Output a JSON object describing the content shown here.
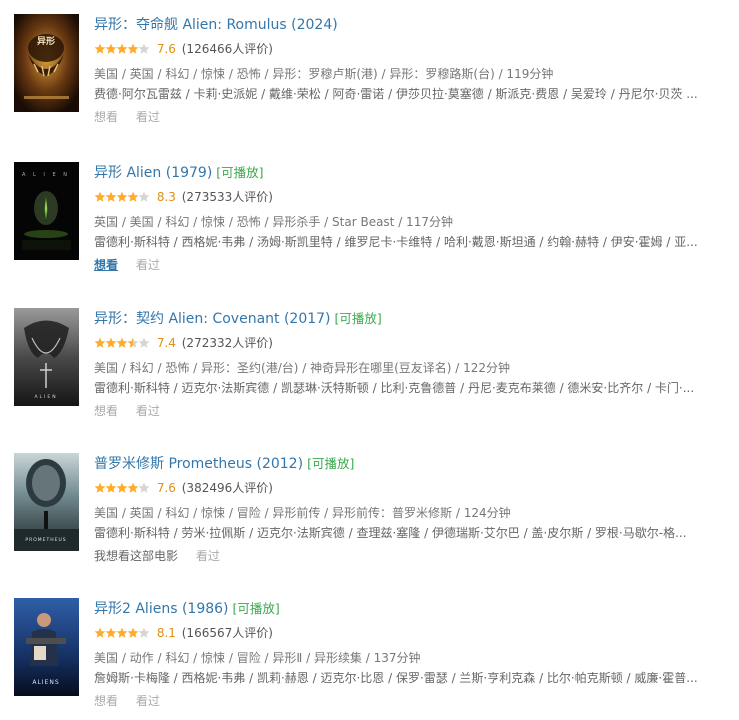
{
  "colors": {
    "title_link": "#3377aa",
    "playable": "#3ba94d",
    "star": "#ffac2d",
    "score": "#e09015"
  },
  "items": [
    {
      "title": "异形：夺命舰 Alien: Romulus (2024)",
      "playable": "",
      "stars": 4,
      "score": "7.6",
      "votes": "(126466人评价)",
      "meta": "美国 / 英国 / 科幻 / 惊悚 / 恐怖 / 异形：罗穆卢斯(港) / 异形：罗穆路斯(台) / 119分钟",
      "cast": "费德·阿尔瓦雷兹 / 卡莉·史派妮 / 戴维·荣松 / 阿奇·雷诺 / 伊莎贝拉·莫塞德 / 斯派克·费恩 / 吴爱玲 / 丹尼尔·贝茨 ...",
      "want": "想看",
      "seen": "看过",
      "poster_icon": "alien-romulus-poster"
    },
    {
      "title": "异形 Alien (1979)",
      "playable": "[可播放]",
      "stars": 4,
      "score": "8.3",
      "votes": "(273533人评价)",
      "meta": "英国 / 美国 / 科幻 / 惊悚 / 恐怖 / 异形杀手 / Star Beast / 117分钟",
      "cast": "雷德利·斯科特 / 西格妮·韦弗 / 汤姆·斯凯里特 / 维罗尼卡·卡维特 / 哈利·戴恩·斯坦通 / 约翰·赫特 / 伊安·霍姆 / 亚...",
      "want": "想看",
      "seen": "看过",
      "poster_icon": "alien-egg-poster"
    },
    {
      "title": "异形：契约 Alien: Covenant (2017)",
      "playable": "[可播放]",
      "stars": 3.5,
      "score": "7.4",
      "votes": "(272332人评价)",
      "meta": "美国 / 科幻 / 恐怖 / 异形：圣约(港/台) / 神奇异形在哪里(豆友译名) / 122分钟",
      "cast": "雷德利·斯科特 / 迈克尔·法斯宾德 / 凯瑟琳·沃特斯顿 / 比利·克鲁德普 / 丹尼·麦克布莱德 / 德米安·比齐尔 / 卡门·...",
      "want": "想看",
      "seen": "看过",
      "poster_icon": "alien-covenant-poster"
    },
    {
      "title": "普罗米修斯 Prometheus (2012)",
      "playable": "[可播放]",
      "stars": 4,
      "score": "7.6",
      "votes": "(382496人评价)",
      "meta": "美国 / 英国 / 科幻 / 惊悚 / 冒险 / 异形前传 / 异形前传：普罗米修斯 / 124分钟",
      "cast": "雷德利·斯科特 / 劳米·拉佩斯 / 迈克尔·法斯宾德 / 查理兹·塞隆 / 伊德瑞斯·艾尔巴 / 盖·皮尔斯 / 罗根·马歇尔-格...",
      "want": "我想看这部电影",
      "seen": "看过",
      "poster_icon": "prometheus-poster"
    },
    {
      "title": "异形2 Aliens (1986)",
      "playable": "[可播放]",
      "stars": 4,
      "score": "8.1",
      "votes": "(166567人评价)",
      "meta": "美国 / 动作 / 科幻 / 惊悚 / 冒险 / 异形Ⅱ / 异形续集 / 137分钟",
      "cast": "詹姆斯·卡梅隆 / 西格妮·韦弗 / 凯莉·赫恩 / 迈克尔·比恩 / 保罗·雷瑟 / 兰斯·亨利克森 / 比尔·帕克斯顿 / 威廉·霍普...",
      "want": "想看",
      "seen": "看过",
      "poster_icon": "aliens-poster"
    }
  ]
}
